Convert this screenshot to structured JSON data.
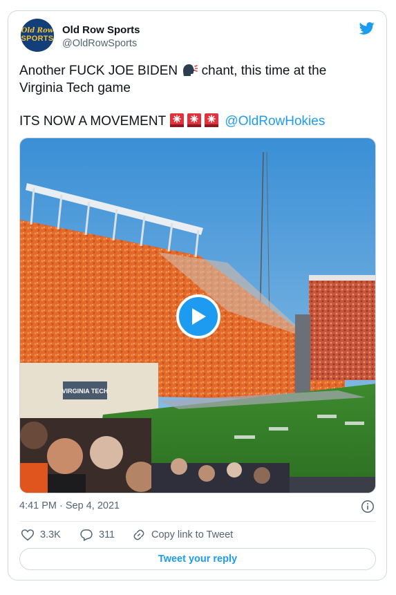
{
  "author": {
    "name": "Old Row Sports",
    "handle": "@OldRowSports",
    "avatar_line1": "Old Row",
    "avatar_line2": "SPORTS"
  },
  "tweet": {
    "line1_before_emoji": "Another FUCK JOE BIDEN ",
    "line1_after_emoji": " chant, this time at the",
    "line2": "Virginia Tech game",
    "line3": "ITS NOW A MOVEMENT ",
    "mention": "@OldRowHokies",
    "emojis": [
      "speaking-head-emoji",
      "siren-emoji",
      "siren-emoji",
      "siren-emoji"
    ]
  },
  "media": {
    "type": "video",
    "banner_text": "VIRGINIA TECH"
  },
  "timestamp": "4:41 PM · Sep 4, 2021",
  "actions": {
    "likes": "3.3K",
    "replies": "311",
    "copy_link": "Copy link to Tweet"
  },
  "reply_button": "Tweet your reply",
  "colors": {
    "accent": "#1d9bf0",
    "text": "#0f1419",
    "secondary": "#536471",
    "border": "#cfd9de"
  }
}
